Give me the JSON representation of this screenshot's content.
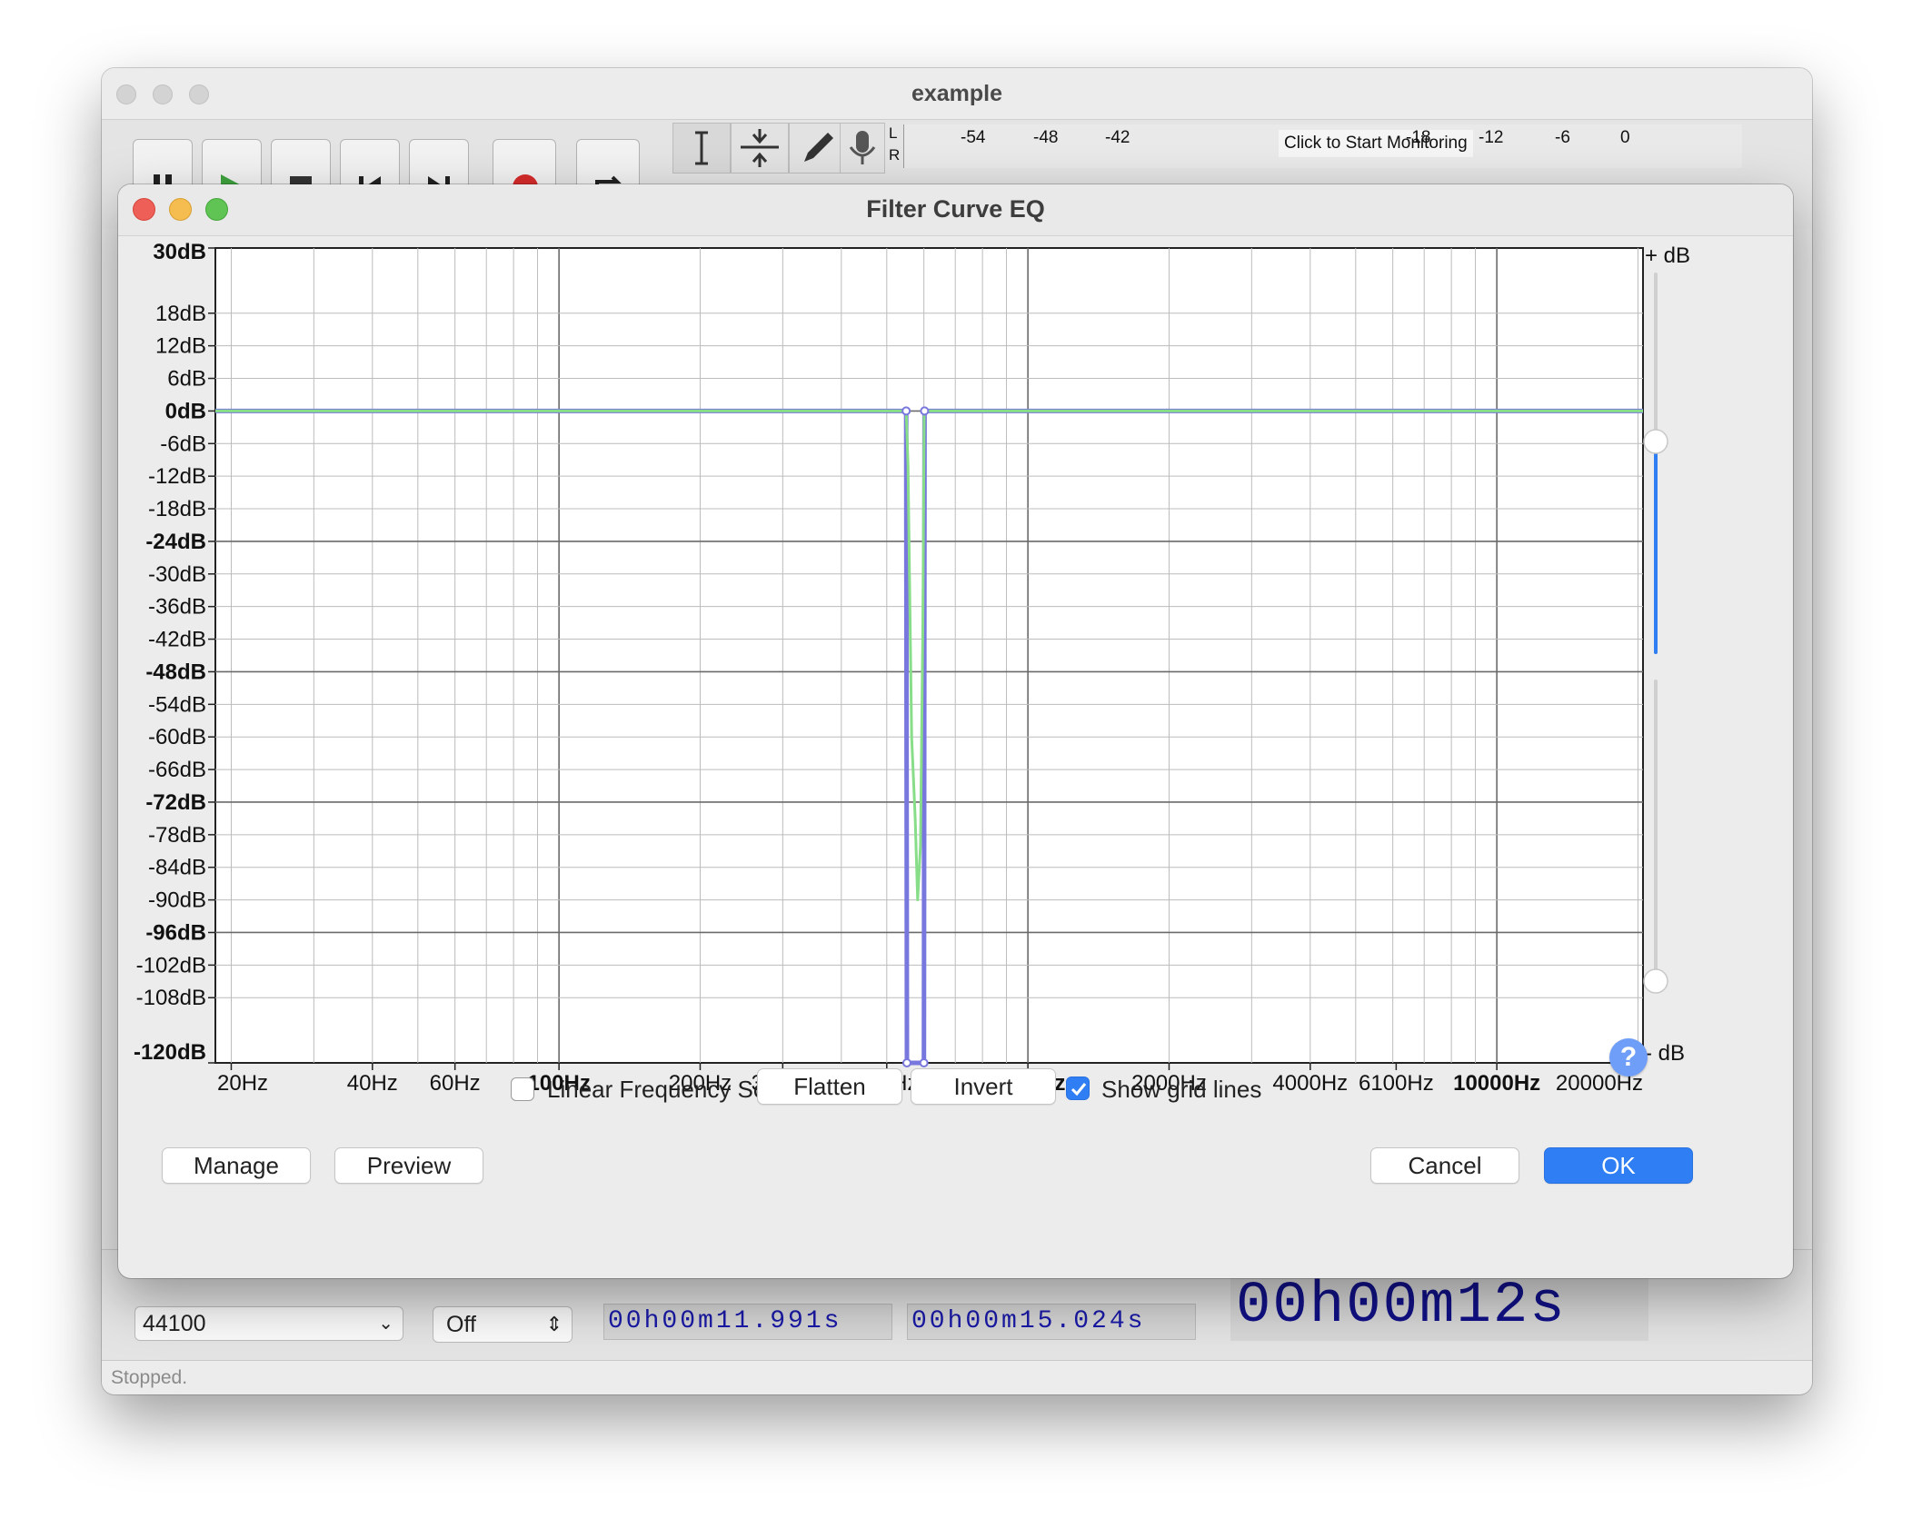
{
  "app": {
    "window_title": "example",
    "meter": {
      "channels": [
        "L",
        "R"
      ],
      "ticks": [
        "-54",
        "-48",
        "-42",
        "-18",
        "-12",
        "-6",
        "0"
      ],
      "monitor_label": "Click to Start Monitoring"
    },
    "bottom": {
      "project_rate": "44100",
      "snap": "Off",
      "selection_start": "00h00m11.991s",
      "selection_end": "00h00m15.024s",
      "audio_position": "00h00m12s"
    },
    "status": "Stopped."
  },
  "dialog": {
    "title": "Filter Curve EQ",
    "db_top_label": "+ dB",
    "db_bottom_label": "- dB",
    "controls": {
      "linear_scale_label": "Linear Frequency Scale",
      "linear_scale_checked": false,
      "flatten_label": "Flatten",
      "invert_label": "Invert",
      "grid_label": "Show grid lines",
      "grid_checked": true
    },
    "buttons": {
      "manage": "Manage",
      "preview": "Preview",
      "cancel": "Cancel",
      "ok": "OK",
      "help": "?"
    },
    "colors": {
      "curve": "#7777dd",
      "response": "#88dd88",
      "ok_button": "#2f7ef4",
      "slider_fill": "#2f7ef4"
    }
  },
  "chart_data": {
    "type": "line",
    "y_tick_labels": [
      "30dB",
      "18dB",
      "12dB",
      "6dB",
      "0dB",
      "-6dB",
      "-12dB",
      "-18dB",
      "-24dB",
      "-30dB",
      "-36dB",
      "-42dB",
      "-48dB",
      "-54dB",
      "-60dB",
      "-66dB",
      "-72dB",
      "-78dB",
      "-84dB",
      "-90dB",
      "-96dB",
      "-102dB",
      "-108dB",
      "-120dB"
    ],
    "y_tick_values": [
      30,
      18,
      12,
      6,
      0,
      -6,
      -12,
      -18,
      -24,
      -30,
      -36,
      -42,
      -48,
      -54,
      -60,
      -66,
      -72,
      -78,
      -84,
      -90,
      -96,
      -102,
      -108,
      -120
    ],
    "y_bold_values": [
      30,
      0,
      -24,
      -48,
      -72,
      -96,
      -120
    ],
    "x_tick_labels": [
      "20Hz",
      "40Hz",
      "60Hz",
      "100Hz",
      "200Hz",
      "300Hz",
      "500Hz",
      "1000Hz",
      "2000Hz",
      "4000Hz",
      "6100Hz",
      "10000Hz",
      "20000Hz"
    ],
    "x_tick_values": [
      20,
      40,
      60,
      100,
      200,
      300,
      500,
      1000,
      2000,
      4000,
      6100,
      10000,
      20000
    ],
    "x_bold_values": [
      100,
      1000,
      10000
    ],
    "x_range": [
      18.5,
      20500
    ],
    "y_range": [
      -120,
      30
    ],
    "x_scale": "log",
    "grid": true,
    "series": [
      {
        "x": [
          18.5,
          550,
          552,
          600,
          602,
          20500
        ],
        "y": [
          0,
          0,
          -120,
          -120,
          0,
          0
        ]
      },
      {
        "x": [
          18.5,
          550,
          555,
          565,
          575,
          582,
          590,
          597,
          601,
          20500
        ],
        "y": [
          0,
          0,
          -10,
          -60,
          -75,
          -90,
          -80,
          -40,
          0,
          0
        ]
      }
    ],
    "control_points": [
      {
        "x": 550,
        "y": 0
      },
      {
        "x": 552,
        "y": -120
      },
      {
        "x": 600,
        "y": -120
      },
      {
        "x": 602,
        "y": 0
      }
    ],
    "gain_slider_top": 0,
    "gain_slider_bottom": -120
  }
}
